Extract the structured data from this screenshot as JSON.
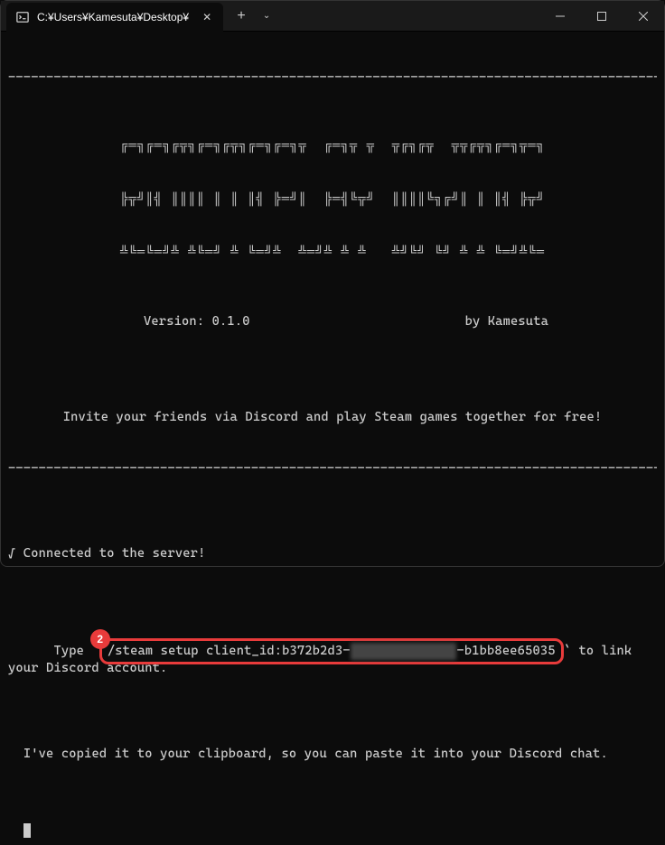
{
  "titlebar": {
    "tab_title": "C:¥Users¥Kamesuta¥Desktop¥",
    "new_tab_label": "+",
    "dropdown_label": "⌄"
  },
  "ascii": {
    "line1": "╔═╗╔═╗╔╦╗╔═╗╔╦╗╔═╗╔═╗╦  ╔═╗╦ ╦  ╦╔╗╔╦  ╦╦╔╦╗╔═╗╦═╗",
    "line2": "╠╦╝║╣ ║║║║ ║ ║ ║╣ ╠═╝║  ╠═╣╚╦╝  ║║║║╚╗╔╝║ ║ ║╣ ╠╦╝",
    "line3": "╩╚═╚═╝╩ ╩╚═╝ ╩ ╚═╝╩  ╩═╝╩ ╩ ╩   ╩╝╚╝ ╚╝ ╩ ╩ ╚═╝╩╚═"
  },
  "meta": {
    "version": "Version: 0.1.0",
    "author": "by Kamesuta"
  },
  "tagline": "Invite your friends via Discord and play Steam games together for free!",
  "status": "√ Connected to the server!",
  "cmd": {
    "prefix": "Type `",
    "command_pre": "/steam setup client_id:b372b2d3-",
    "redacted": "xxxx-xxxx-xxxx",
    "command_post": "-b1bb8ee65035",
    "suffix": "` to link your Discord account.",
    "badge": "2"
  },
  "copied": "I've copied it to your clipboard, so you can paste it into your Discord chat.",
  "divider": "-----------------------------------------------------------------------------------------"
}
